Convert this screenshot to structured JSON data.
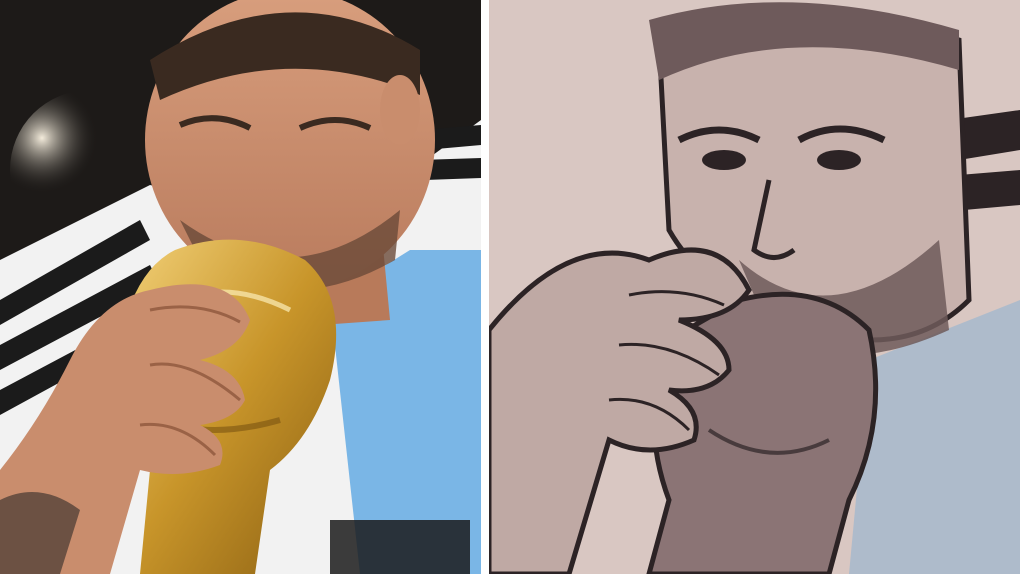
{
  "collage": {
    "layout": "side-by-side",
    "panels": [
      {
        "id": "left",
        "kind": "photograph",
        "description_icon": "photo-icon",
        "colors": {
          "background": "#1d1a18",
          "skin": "#c98d6d",
          "hair": "#3a2a20",
          "trophy_gold": "#d2a63a",
          "shirt_white": "#f2f2f2",
          "shirt_blue": "#7ab6e6",
          "stripe_black": "#1b1b1b"
        }
      },
      {
        "id": "right",
        "kind": "tattoo",
        "description_icon": "tattoo-icon",
        "colors": {
          "skin": "#d9c7c2",
          "ink_dark": "#2c2325",
          "ink_mid": "#6e5a5b",
          "blue_wash": "#9bb6cf"
        }
      }
    ]
  }
}
